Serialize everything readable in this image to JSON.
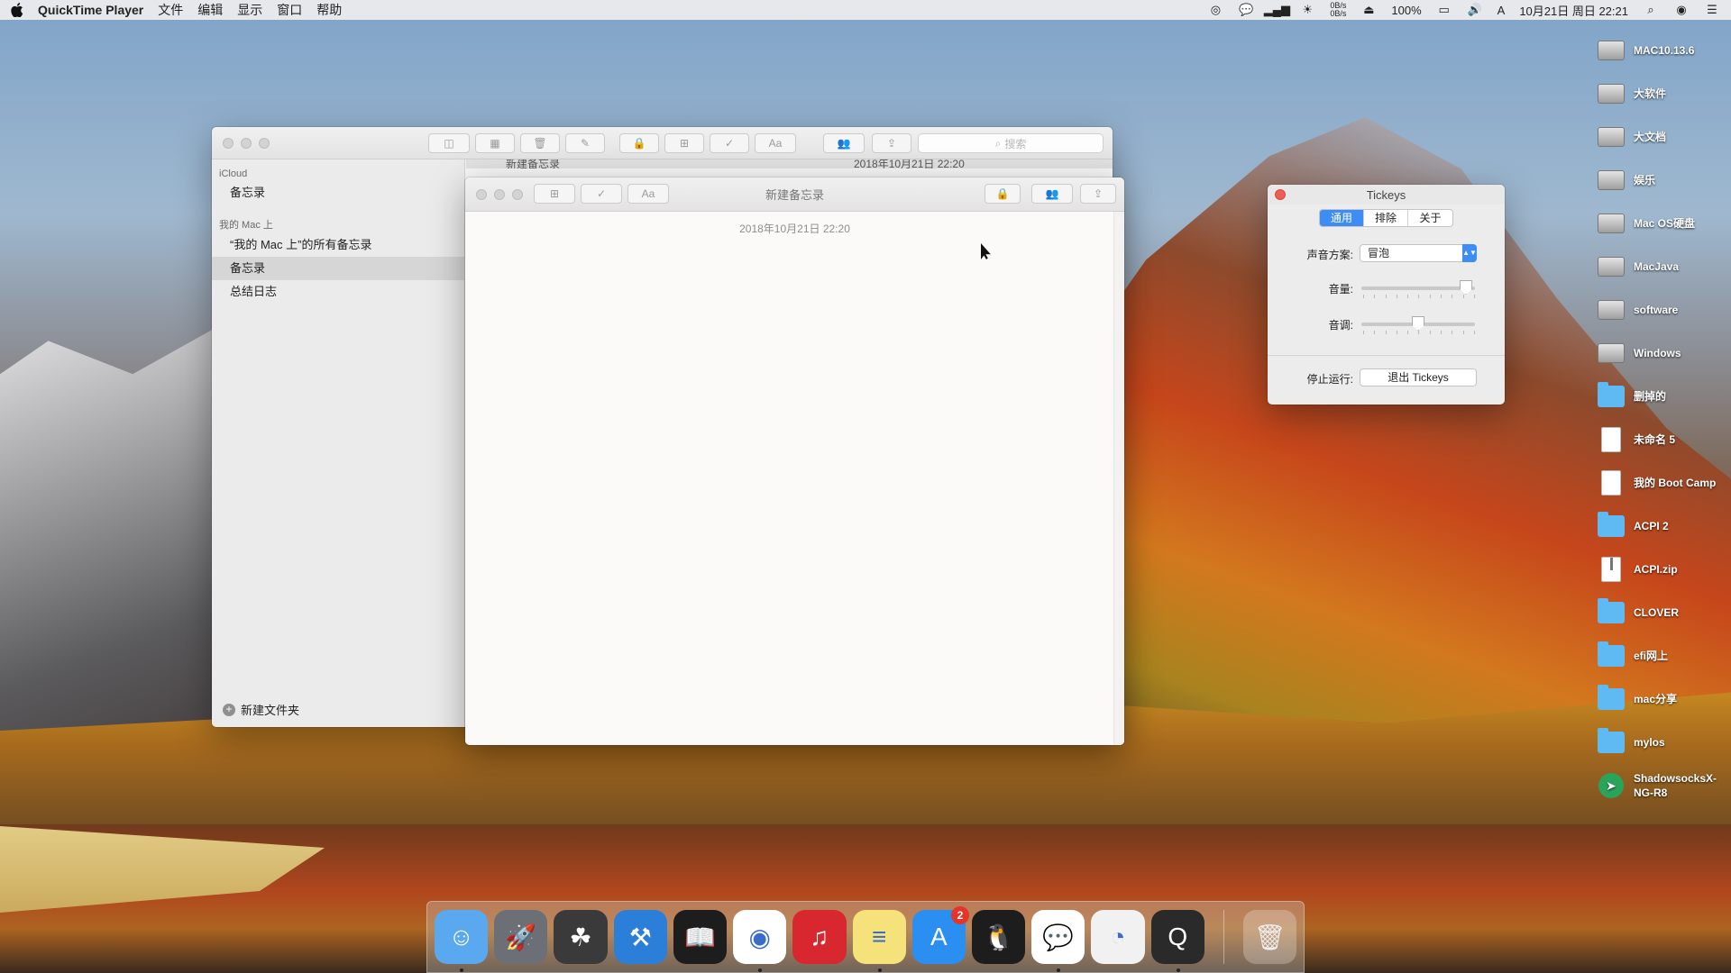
{
  "menubar": {
    "app_name": "QuickTime Player",
    "menus": [
      "文件",
      "编辑",
      "显示",
      "窗口",
      "帮助"
    ],
    "status": {
      "net_up": "0B/s",
      "net_down": "0B/s",
      "battery": "100%",
      "input_method": "A",
      "clock": "10月21日 周日 22:21"
    }
  },
  "notes_window": {
    "search_placeholder": "搜索",
    "list_peek_title": "新建备忘录",
    "list_peek_date": "2018年10月21日 22:20",
    "sidebar": {
      "icloud_header": "iCloud",
      "icloud_items": [
        "备忘录"
      ],
      "mac_header": "我的 Mac 上",
      "mac_items": [
        "“我的 Mac 上”的所有备忘录",
        "备忘录",
        "总结日志"
      ],
      "selected_mac_item": 1,
      "new_folder": "新建文件夹"
    }
  },
  "note_window": {
    "title": "新建备忘录",
    "date": "2018年10月21日 22:20"
  },
  "tickeys": {
    "title": "Tickeys",
    "tabs": [
      "通用",
      "排除",
      "关于"
    ],
    "active_tab": 0,
    "sound_scheme_label": "声音方案:",
    "sound_scheme_value": "冒泡",
    "volume_label": "音量:",
    "volume_level": 0.92,
    "pitch_label": "音调:",
    "pitch_level": 0.5,
    "stop_label": "停止运行:",
    "quit_button": "退出 Tickeys"
  },
  "desktop_icons": [
    {
      "label": "MAC10.13.6",
      "icon": "drive"
    },
    {
      "label": "大软件",
      "icon": "drive"
    },
    {
      "label": "大文档",
      "icon": "drive"
    },
    {
      "label": "娱乐",
      "icon": "drive"
    },
    {
      "label": "Mac OS硬盘",
      "icon": "drive"
    },
    {
      "label": "MacJava",
      "icon": "drive"
    },
    {
      "label": "software",
      "icon": "drive"
    },
    {
      "label": "Windows",
      "icon": "drive"
    },
    {
      "label": "删掉的",
      "icon": "folder"
    },
    {
      "label": "未命名 5",
      "icon": "file"
    },
    {
      "label": "我的 Boot Camp",
      "icon": "file"
    },
    {
      "label": "ACPI 2",
      "icon": "folder"
    },
    {
      "label": "ACPI.zip",
      "icon": "zip"
    },
    {
      "label": "CLOVER",
      "icon": "folder"
    },
    {
      "label": "efi网上",
      "icon": "folder"
    },
    {
      "label": "mac分享",
      "icon": "folder"
    },
    {
      "label": "mylos",
      "icon": "folder"
    },
    {
      "label": "ShadowsocksX-NG-R8",
      "icon": "app"
    }
  ],
  "dock": {
    "apps": [
      {
        "name": "finder",
        "running": true
      },
      {
        "name": "launchpad",
        "running": false
      },
      {
        "name": "clover-configurator",
        "running": false
      },
      {
        "name": "xcode",
        "running": false
      },
      {
        "name": "kindle",
        "running": false
      },
      {
        "name": "chrome",
        "running": true
      },
      {
        "name": "netease-music",
        "running": false
      },
      {
        "name": "notes",
        "running": true
      },
      {
        "name": "app-store",
        "running": false,
        "badge": "2"
      },
      {
        "name": "qq",
        "running": false
      },
      {
        "name": "wechat",
        "running": true
      },
      {
        "name": "disk-speed",
        "running": false
      },
      {
        "name": "quicktime",
        "running": true
      }
    ],
    "trash": "trash"
  },
  "colors": {
    "accent": "#3e8df5",
    "close_red": "#ec5f57",
    "badge_red": "#e5342a"
  }
}
